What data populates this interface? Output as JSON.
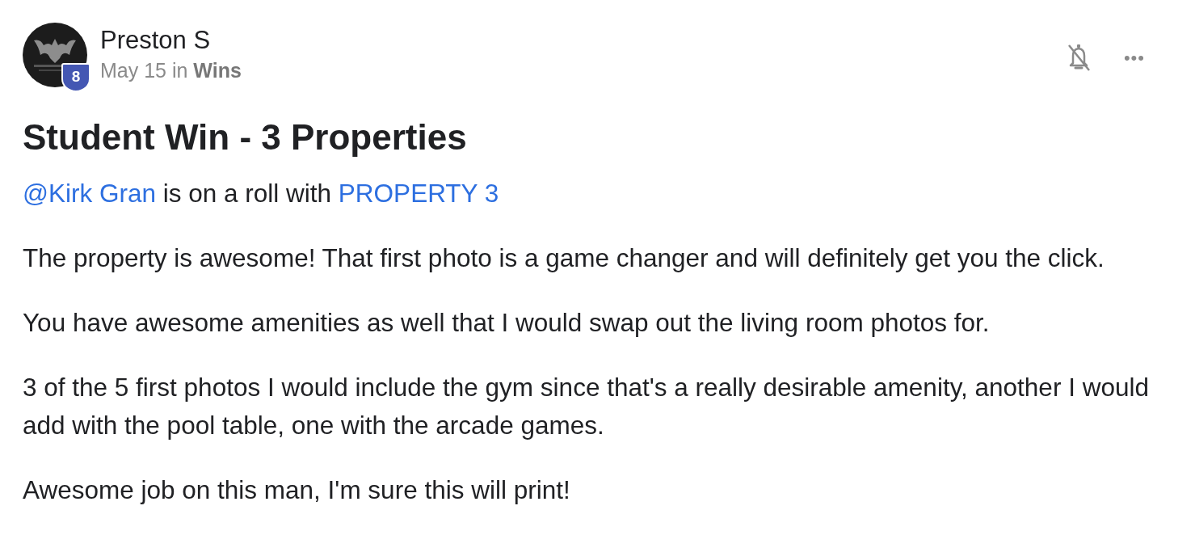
{
  "post": {
    "author": "Preston S",
    "level_badge": "8",
    "meta": "May 15 in **Wins**",
    "title": "Student Win - 3 Properties",
    "notifications_muted": true,
    "more_label": "•••",
    "paragraphs": [
      {
        "parts": [
          {
            "kind": "mention",
            "text": "@Kirk Gran"
          },
          {
            "kind": "text",
            "text": " is on a roll with "
          },
          {
            "kind": "link",
            "text": "PROPERTY 3"
          }
        ]
      },
      {
        "parts": [
          {
            "kind": "text",
            "text": "The property is awesome! That first photo is a game changer and will definitely get you the click."
          }
        ]
      },
      {
        "parts": [
          {
            "kind": "text",
            "text": "You have awesome amenities as well that I would swap out the living room photos for."
          }
        ]
      },
      {
        "parts": [
          {
            "kind": "text",
            "text": "3 of the 5 first photos I would include the gym since that's a really desirable amenity, another I would add with the pool table, one with the arcade games."
          }
        ]
      },
      {
        "parts": [
          {
            "kind": "text",
            "text": "Awesome job on this man, I'm sure this will print!"
          }
        ]
      }
    ]
  }
}
